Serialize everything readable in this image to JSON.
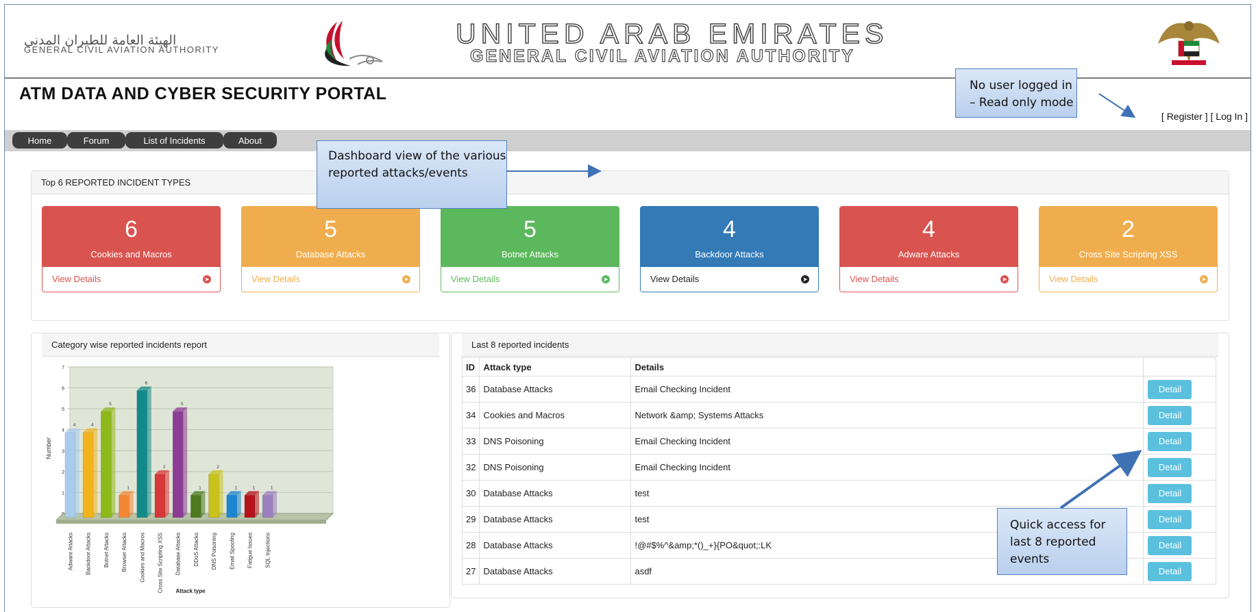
{
  "header": {
    "gcaa_arabic": "الهيئة العامة للطيران المدني",
    "gcaa_english": "GENERAL CIVIL AVIATION AUTHORITY",
    "country_title": "UNITED ARAB EMIRATES",
    "authority_title": "GENERAL CIVIL AVIATION AUTHORITY",
    "portal_title": "ATM DATA AND CYBER SECURITY PORTAL",
    "register_link": "[ Register ]",
    "login_link": "[ Log In ]"
  },
  "nav": {
    "tabs": [
      {
        "label": "Home"
      },
      {
        "label": "Forum"
      },
      {
        "label": "List of Incidents"
      },
      {
        "label": "About"
      }
    ]
  },
  "top_incidents": {
    "title": "Top 6 REPORTED INCIDENT TYPES",
    "cards": [
      {
        "count": "6",
        "label": "Cookies and Macros",
        "link": "View Details",
        "color": "#d9534f"
      },
      {
        "count": "5",
        "label": "Database Attacks",
        "link": "View Details",
        "color": "#f0ad4e"
      },
      {
        "count": "5",
        "label": "Botnet Attacks",
        "link": "View Details",
        "color": "#5cb85c"
      },
      {
        "count": "4",
        "label": "Backdoor Attacks",
        "link": "View Details",
        "color": "#337ab7"
      },
      {
        "count": "4",
        "label": "Adware Attacks",
        "link": "View Details",
        "color": "#d9534f"
      },
      {
        "count": "2",
        "label": "Cross Site Scripting XSS",
        "link": "View Details",
        "color": "#f0ad4e"
      }
    ]
  },
  "category_report": {
    "title": "Category wise reported incidents report"
  },
  "chart_data": {
    "type": "bar",
    "categories": [
      "Adware Attacks",
      "Backdoor Attacks",
      "Botnet Attacks",
      "Browser Attacks",
      "Cookies and Macros",
      "Cross Site Scripting XSS",
      "Database Attacks",
      "DDoS Attacks",
      "DNS Poisoning",
      "Email Spoofing",
      "Fatigue Issues",
      "SQL Injections"
    ],
    "values": [
      4,
      4,
      5,
      1,
      6,
      2,
      5,
      1,
      2,
      1,
      1,
      1
    ],
    "colors": [
      "#a8cbed",
      "#f2b41c",
      "#8fb81a",
      "#f58634",
      "#138a8a",
      "#d9383a",
      "#8c3c94",
      "#4d7a1e",
      "#c9c21c",
      "#1c86d1",
      "#b5121b",
      "#9b7fc0"
    ],
    "xlabel": "Attack type",
    "ylabel": "Number",
    "ylim": [
      0,
      7
    ],
    "yticks": [
      "0",
      "1",
      "2",
      "3",
      "4",
      "5",
      "6",
      "7"
    ],
    "grid": true
  },
  "last_incidents": {
    "title": "Last 8 reported incidents",
    "columns": [
      "ID",
      "Attack type",
      "Details",
      ""
    ],
    "rows": [
      {
        "id": "36",
        "type": "Database Attacks",
        "details": "Email Checking Incident",
        "action": "Detail"
      },
      {
        "id": "34",
        "type": "Cookies and Macros",
        "details": "Network &amp; Systems Attacks",
        "action": "Detail"
      },
      {
        "id": "33",
        "type": "DNS Poisoning",
        "details": "Email Checking Incident",
        "action": "Detail"
      },
      {
        "id": "32",
        "type": "DNS Poisoning",
        "details": "Email Checking Incident",
        "action": "Detail"
      },
      {
        "id": "30",
        "type": "Database Attacks",
        "details": "test",
        "action": "Detail"
      },
      {
        "id": "29",
        "type": "Database Attacks",
        "details": "test",
        "action": "Detail"
      },
      {
        "id": "28",
        "type": "Database Attacks",
        "details": "!@#$%^&amp;*()_+}{PO&quot;:LK",
        "action": "Detail"
      },
      {
        "id": "27",
        "type": "Database Attacks",
        "details": "asdf",
        "action": "Detail"
      }
    ]
  },
  "callouts": {
    "login_note": "No user logged in – Read only mode",
    "dashboard_note": "Dashboard view of the various reported attacks/events",
    "quick_access_note": "Quick access for last 8 reported events"
  }
}
